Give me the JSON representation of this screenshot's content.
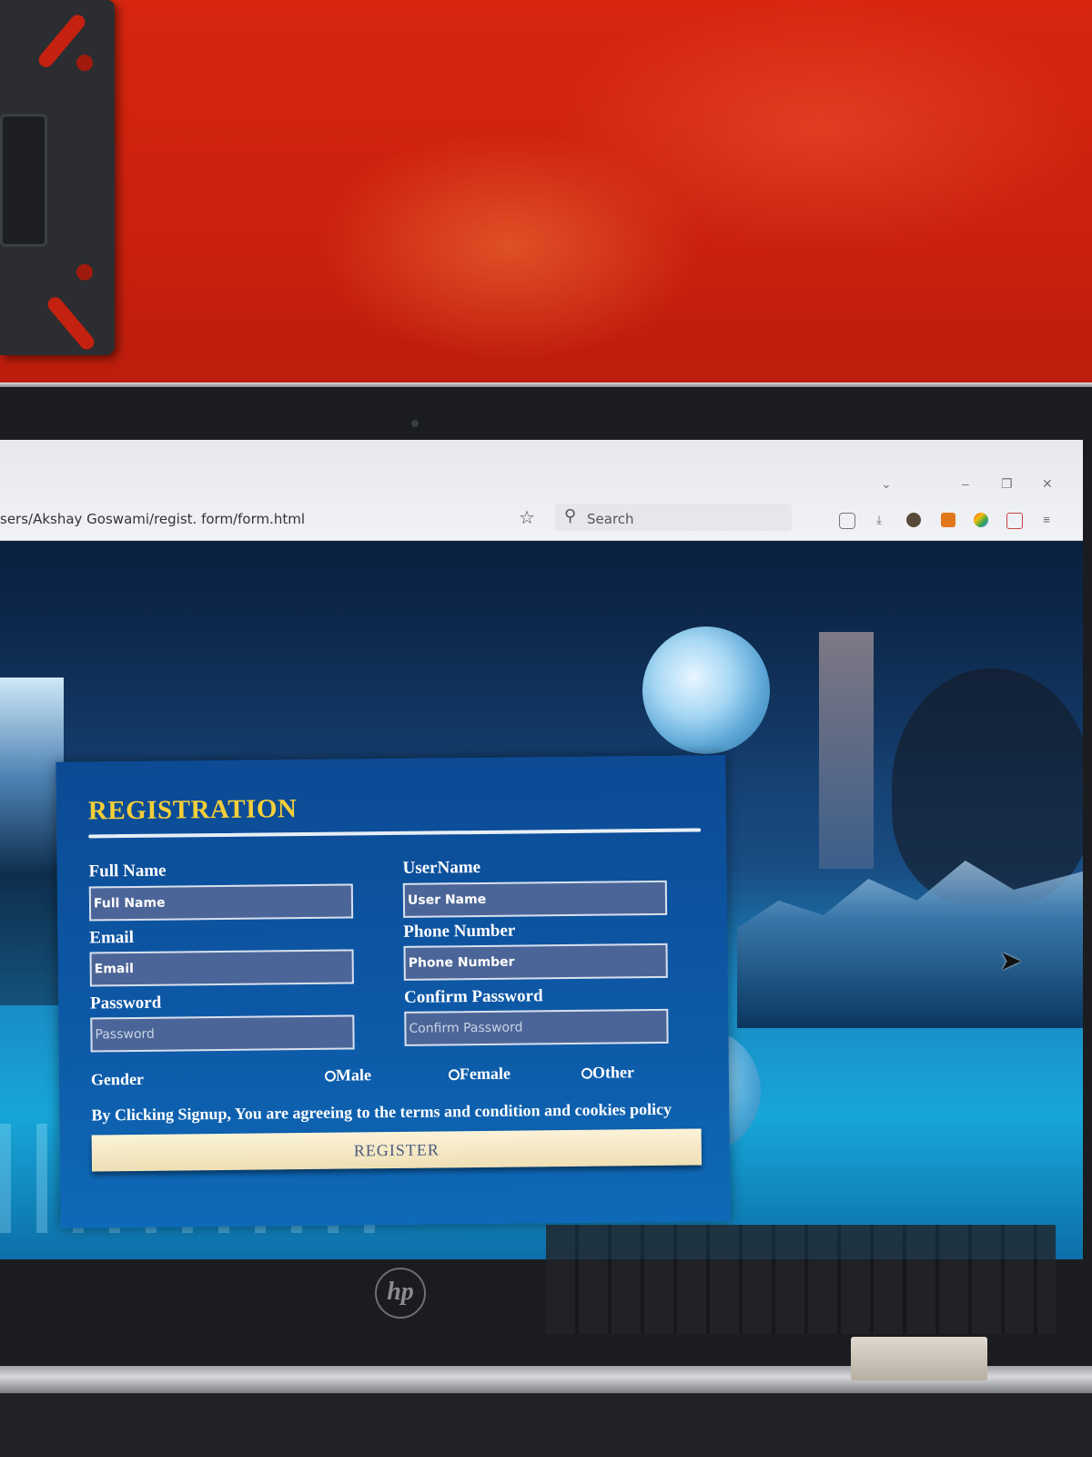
{
  "browser": {
    "url": "sers/Akshay Goswami/regist. form/form.html",
    "search_placeholder": "Search"
  },
  "form": {
    "title": "REGISTRATION",
    "fields": {
      "full_name": {
        "label": "Full Name",
        "placeholder": "Full Name"
      },
      "username": {
        "label": "UserName",
        "placeholder": "User Name"
      },
      "email": {
        "label": "Email",
        "placeholder": "Email"
      },
      "phone": {
        "label": "Phone Number",
        "placeholder": "Phone Number"
      },
      "password": {
        "label": "Password",
        "placeholder": "Password"
      },
      "confirm_password": {
        "label": "Confirm Password",
        "placeholder": "Confirm Password"
      }
    },
    "gender": {
      "label": "Gender",
      "options": [
        "Male",
        "Female",
        "Other"
      ]
    },
    "terms": "By Clicking Signup, You are agreeing to the terms and condition and cookies policy",
    "submit_label": "REGISTER",
    "colors": {
      "title": "#f4cf3a",
      "card": "#0d5aa8",
      "button": "#f5e9c6"
    }
  },
  "device": {
    "logo": "hp"
  },
  "icons": [
    "star-icon",
    "search-icon",
    "pocket-icon",
    "download-icon",
    "extension-icon",
    "metamask-icon",
    "cursor-icon"
  ]
}
